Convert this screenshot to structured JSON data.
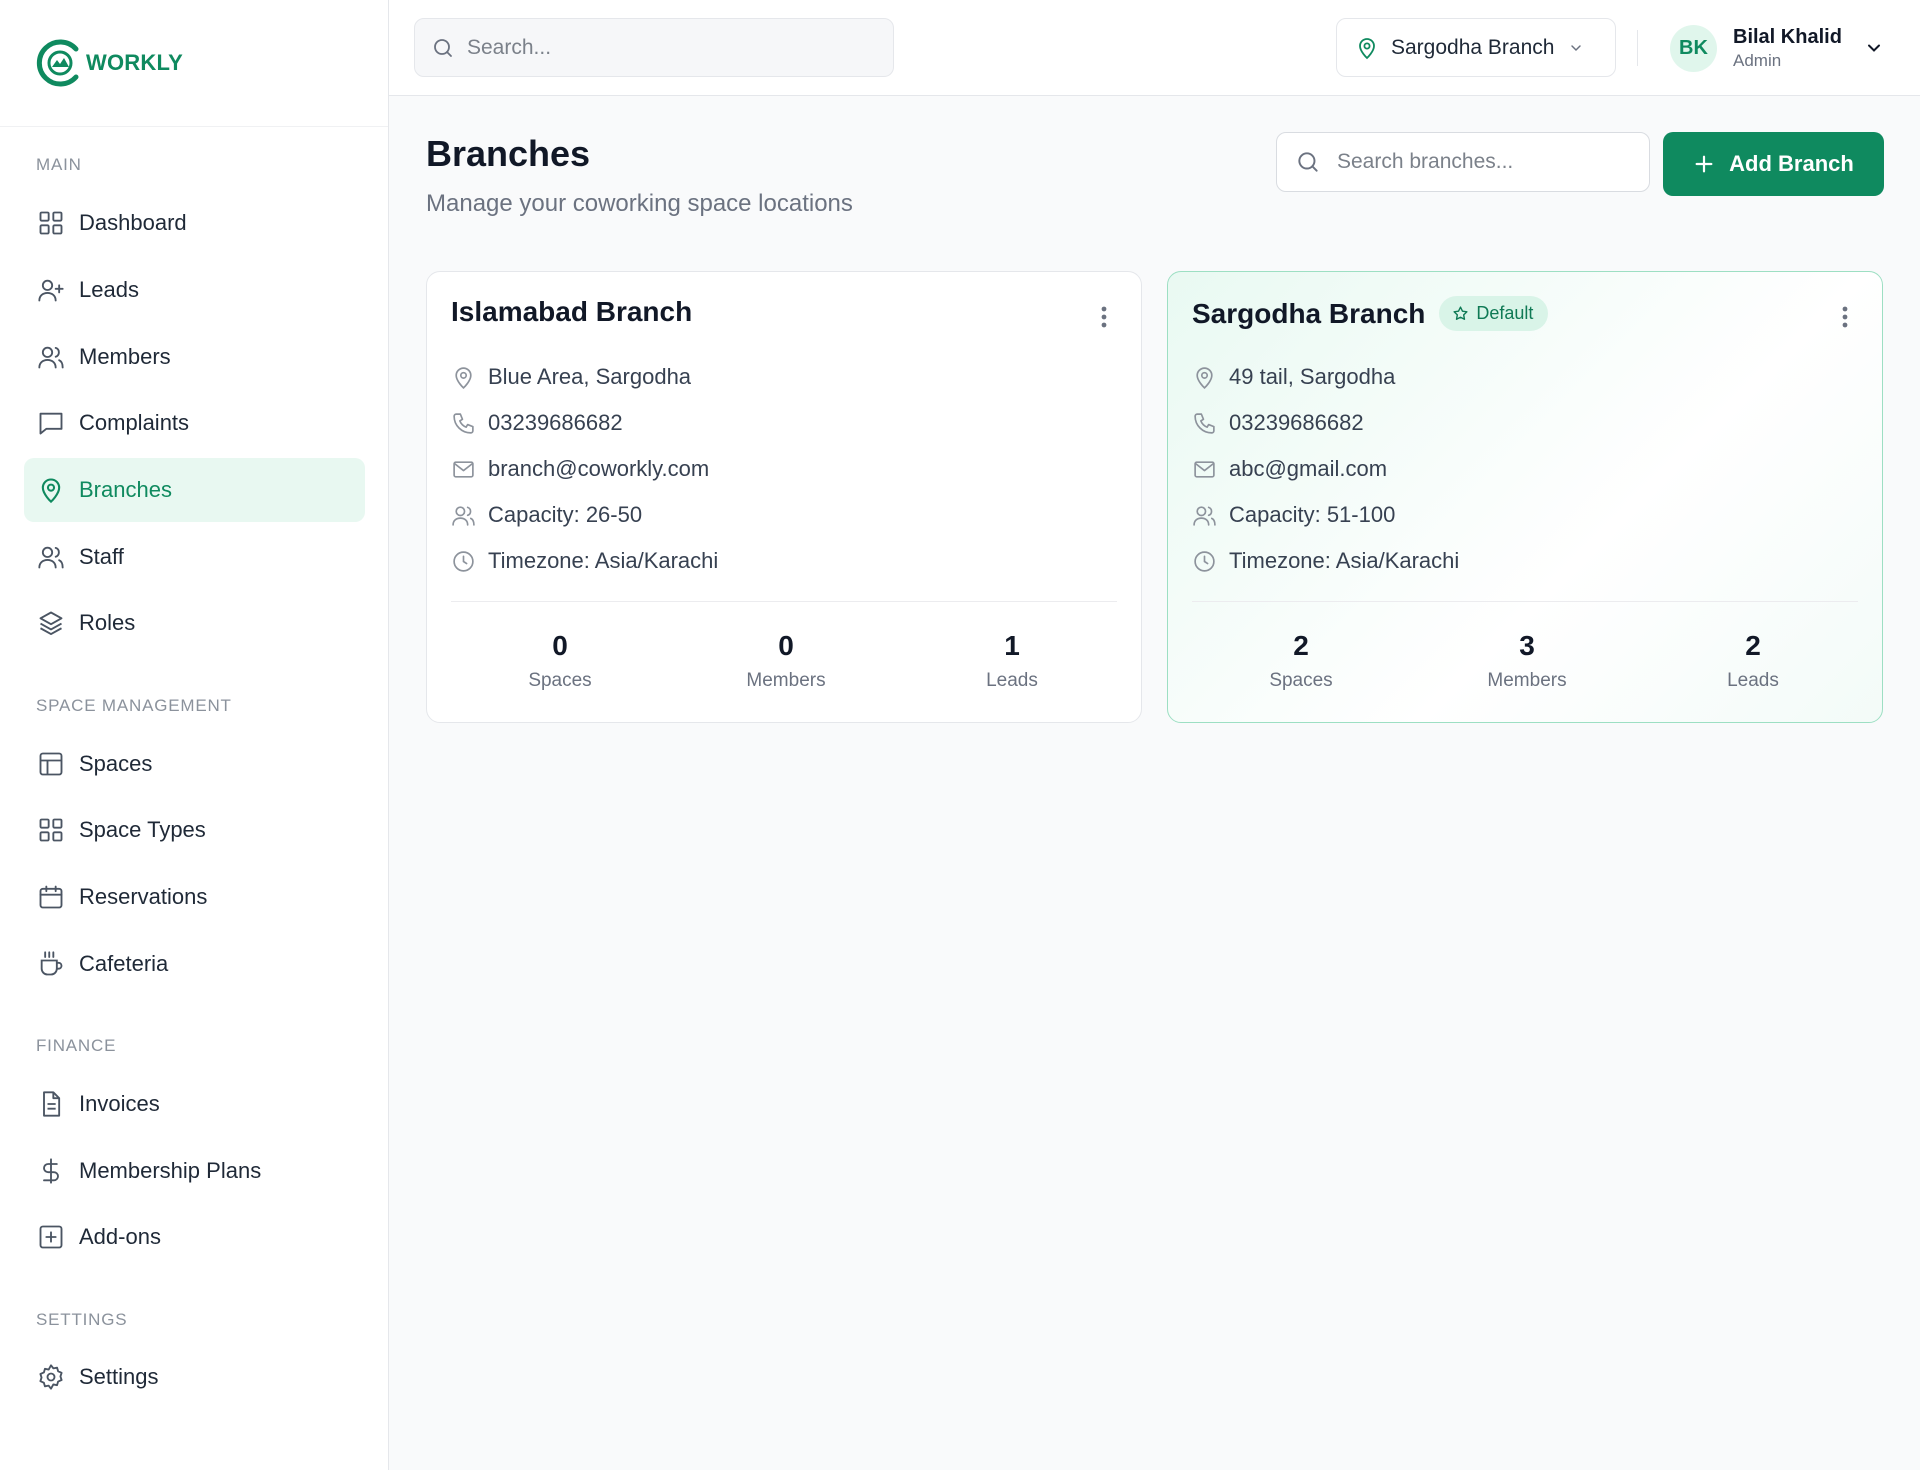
{
  "brand": {
    "name": "WORKLY",
    "color": "#0f8a5f"
  },
  "sidebar": {
    "sections": [
      {
        "title": "MAIN",
        "items": [
          {
            "label": "Dashboard",
            "icon": "grid-icon"
          },
          {
            "label": "Leads",
            "icon": "user-plus-icon"
          },
          {
            "label": "Members",
            "icon": "users-icon"
          },
          {
            "label": "Complaints",
            "icon": "chat-icon"
          },
          {
            "label": "Branches",
            "icon": "map-pin-icon",
            "active": true
          },
          {
            "label": "Staff",
            "icon": "users-icon"
          },
          {
            "label": "Roles",
            "icon": "layers-icon"
          }
        ]
      },
      {
        "title": "SPACE MANAGEMENT",
        "items": [
          {
            "label": "Spaces",
            "icon": "layout-icon"
          },
          {
            "label": "Space Types",
            "icon": "grid-icon"
          },
          {
            "label": "Reservations",
            "icon": "calendar-icon"
          },
          {
            "label": "Cafeteria",
            "icon": "coffee-icon"
          }
        ]
      },
      {
        "title": "FINANCE",
        "items": [
          {
            "label": "Invoices",
            "icon": "file-text-icon"
          },
          {
            "label": "Membership Plans",
            "icon": "dollar-icon"
          },
          {
            "label": "Add-ons",
            "icon": "plus-square-icon"
          }
        ]
      },
      {
        "title": "SETTINGS",
        "items": [
          {
            "label": "Settings",
            "icon": "gear-icon"
          }
        ]
      }
    ]
  },
  "topbar": {
    "search_placeholder": "Search...",
    "branch_selector": "Sargodha Branch",
    "user": {
      "initials": "BK",
      "name": "Bilal Khalid",
      "role": "Admin"
    }
  },
  "page": {
    "title": "Branches",
    "subtitle": "Manage your coworking space locations",
    "search_placeholder": "Search branches...",
    "add_button": "Add Branch"
  },
  "branches": [
    {
      "name": "Islamabad Branch",
      "is_default": false,
      "address": "Blue Area, Sargodha",
      "phone": "03239686682",
      "email": "branch@coworkly.com",
      "capacity": "Capacity: 26-50",
      "timezone": "Timezone: Asia/Karachi",
      "stats": [
        {
          "value": "0",
          "label": "Spaces"
        },
        {
          "value": "0",
          "label": "Members"
        },
        {
          "value": "1",
          "label": "Leads"
        }
      ]
    },
    {
      "name": "Sargodha Branch",
      "is_default": true,
      "badge": "Default",
      "address": "49 tail, Sargodha",
      "phone": "03239686682",
      "email": "abc@gmail.com",
      "capacity": "Capacity: 51-100",
      "timezone": "Timezone: Asia/Karachi",
      "stats": [
        {
          "value": "2",
          "label": "Spaces"
        },
        {
          "value": "3",
          "label": "Members"
        },
        {
          "value": "2",
          "label": "Leads"
        }
      ]
    }
  ]
}
